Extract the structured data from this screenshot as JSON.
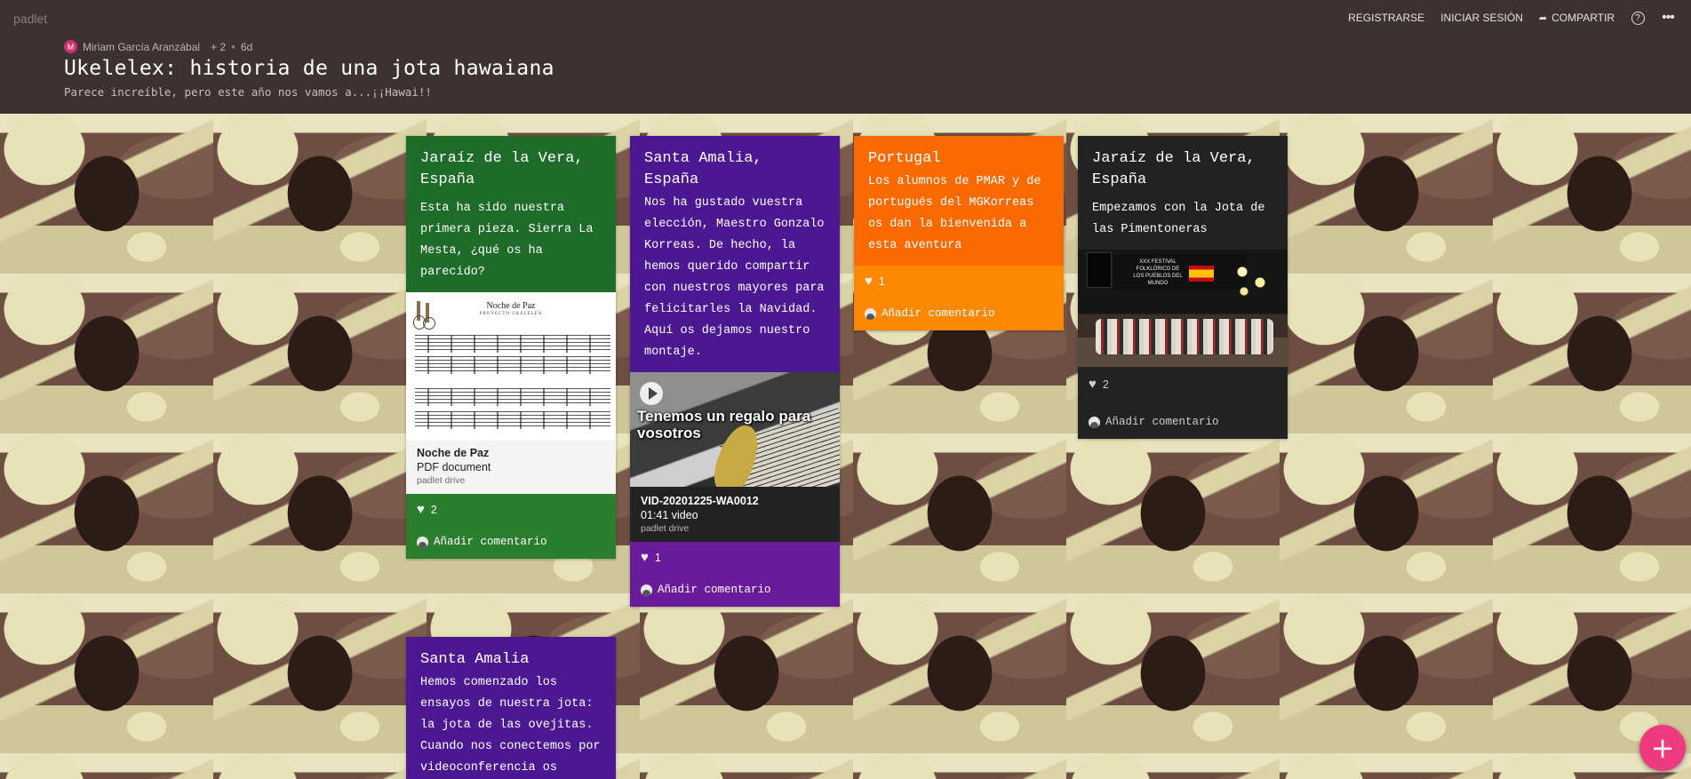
{
  "app": {
    "logo": "padlet"
  },
  "nav": {
    "register": "REGISTRARSE",
    "login": "INICIAR SESIÓN",
    "share": "COMPARTIR",
    "help_icon": "help-icon",
    "more_icon": "more-icon"
  },
  "header": {
    "avatar_letter": "M",
    "author": "Miriam García Aranzábal",
    "contributors": "+ 2",
    "age": "6d",
    "title": "Ukelelex: historia de una jota hawaiana",
    "subtitle": "Parece increíble, pero este año nos vamos a...¡¡Hawai!!"
  },
  "colors": {
    "green": "#1f6b2a",
    "green_foot": "#2c7e2f",
    "purple": "#4b1891",
    "purple_foot": "#6a1b9a",
    "orange": "#fb6a00",
    "orange_foot": "#fe8800",
    "dark": "#222222",
    "fab": "#f03a7f"
  },
  "posts": [
    {
      "title": "Jaraíz de la Vera, España",
      "body": "Esta ha sido nuestra primera pieza. Sierra La Mesta, ¿qué os ha parecido?",
      "attachment": {
        "name": "Noche de Paz",
        "type": "PDF document",
        "source": "padlet drive",
        "preview_title": "Noche de Paz",
        "preview_subtitle": "PROYECTO UKELELEX"
      },
      "likes": "2",
      "comment": "Añadir comentario"
    },
    {
      "title": "Santa Amalia, España",
      "body": "Nos ha gustado vuestra elección, Maestro Gonzalo Korreas. De hecho, la hemos querido compartir con nuestros mayores para felicitarles la Navidad. Aquí os dejamos nuestro montaje.",
      "attachment": {
        "name": "VID-20201225-WA0012",
        "type": "01:41 video",
        "source": "padlet drive",
        "overlay": "Tenemos un regalo para vosotros"
      },
      "likes": "1",
      "comment": "Añadir comentario"
    },
    {
      "title": "Portugal",
      "body": "Los alumnos de PMAR y de portugués del MGKorreas os dan la bienvenida a esta aventura",
      "likes": "1",
      "comment": "Añadir comentario"
    },
    {
      "title": "Jaraíz de la Vera, España",
      "body": "Empezamos con la Jota de las Pimentoneras",
      "photo_text": "XXX FESTIVAL FOLKLÓRICO DE LOS PUEBLOS DEL MUNDO",
      "likes": "2",
      "comment": "Añadir comentario"
    },
    {
      "title": "Santa Amalia",
      "body": "Hemos comenzado los ensayos de nuestra jota: la jota de las ovejitas. Cuando nos conectemos por videoconferencia os"
    }
  ],
  "fab": {
    "label": "+"
  }
}
